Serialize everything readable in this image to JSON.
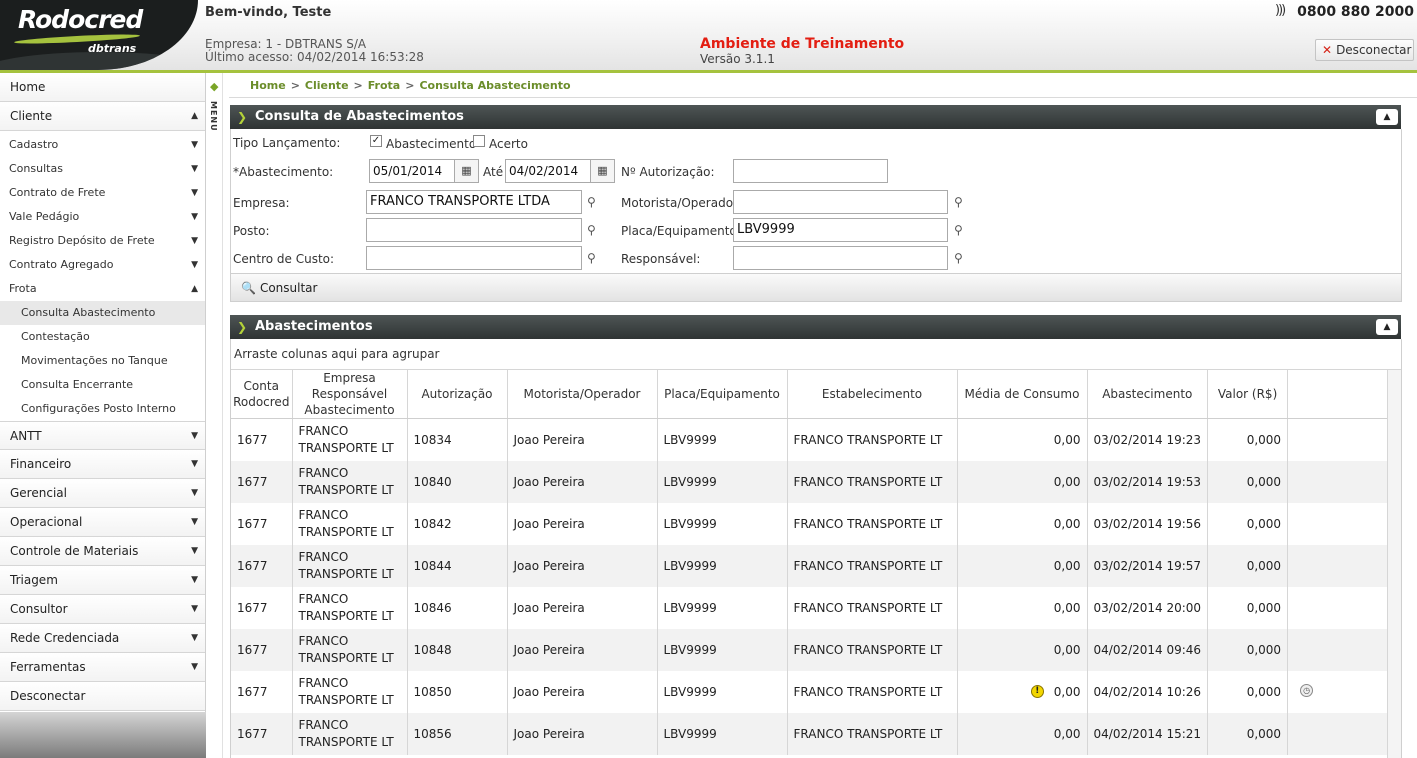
{
  "header": {
    "logo": "Rodocred",
    "logo_sub": "dbtrans",
    "welcome": "Bem-vindo, Teste",
    "empresa": "Empresa: 1 - DBTRANS S/A",
    "ultimo_acesso": "Último acesso: 04/02/2014 16:53:28",
    "env_title": "Ambiente de Treinamento",
    "env_version": "Versão 3.1.1",
    "phone": "0800 880 2000",
    "logout_label": "Desconectar",
    "accent_color": "#a5c23e"
  },
  "sidebar": {
    "home": "Home",
    "cliente": "Cliente",
    "cliente_items": [
      "Cadastro",
      "Consultas",
      "Contrato de Frete",
      "Vale Pedágio",
      "Registro Depósito de Frete",
      "Contrato Agregado"
    ],
    "frota": "Frota",
    "frota_items": [
      "Consulta Abastecimento",
      "Contestação",
      "Movimentações no Tanque",
      "Consulta Encerrante",
      "Configurações Posto Interno"
    ],
    "bottom_items": [
      "ANTT",
      "Financeiro",
      "Gerencial",
      "Operacional",
      "Controle de Materiais",
      "Triagem",
      "Consultor",
      "Rede Credenciada",
      "Ferramentas"
    ],
    "desconectar": "Desconectar",
    "menu_label": "MENU"
  },
  "breadcrumb": [
    "Home",
    "Cliente",
    "Frota",
    "Consulta Abastecimento"
  ],
  "form": {
    "title": "Consulta de Abastecimentos",
    "tipo_label": "Tipo Lançamento:",
    "tipo_abastecimento": "Abastecimento",
    "tipo_acerto": "Acerto",
    "abastecimento_label": "*Abastecimento:",
    "data_inicio": "05/01/2014",
    "ate_label": "Até",
    "data_fim": "04/02/2014",
    "autorizacao_label": "Nº Autorização:",
    "autorizacao_value": "",
    "empresa_label": "Empresa:",
    "empresa_value": "FRANCO TRANSPORTE LTDA",
    "motorista_label": "Motorista/Operador:",
    "motorista_value": "",
    "posto_label": "Posto:",
    "posto_value": "",
    "placa_label": "Placa/Equipamento:",
    "placa_value": "LBV9999",
    "centro_label": "Centro de Custo:",
    "centro_value": "",
    "responsavel_label": "Responsável:",
    "responsavel_value": "",
    "consultar_label": "Consultar"
  },
  "grid": {
    "title": "Abastecimentos",
    "group_hint": "Arraste colunas aqui para agrupar",
    "columns": [
      "Conta Rodocred",
      "Empresa Responsável Abastecimento",
      "Autorização",
      "Motorista/Operador",
      "Placa/Equipamento",
      "Estabelecimento",
      "Média de Consumo",
      "Abastecimento",
      "Valor (R$)"
    ],
    "rows": [
      {
        "conta": "1677",
        "empresa": "FRANCO TRANSPORTE LT",
        "autorizacao": "10834",
        "motorista": "Joao Pereira",
        "placa": "LBV9999",
        "estab": "FRANCO TRANSPORTE LT",
        "media": "0,00",
        "data": "03/02/2014 19:23",
        "valor": "0,000"
      },
      {
        "conta": "1677",
        "empresa": "FRANCO TRANSPORTE LT",
        "autorizacao": "10840",
        "motorista": "Joao Pereira",
        "placa": "LBV9999",
        "estab": "FRANCO TRANSPORTE LT",
        "media": "0,00",
        "data": "03/02/2014 19:53",
        "valor": "0,000"
      },
      {
        "conta": "1677",
        "empresa": "FRANCO TRANSPORTE LT",
        "autorizacao": "10842",
        "motorista": "Joao Pereira",
        "placa": "LBV9999",
        "estab": "FRANCO TRANSPORTE LT",
        "media": "0,00",
        "data": "03/02/2014 19:56",
        "valor": "0,000"
      },
      {
        "conta": "1677",
        "empresa": "FRANCO TRANSPORTE LT",
        "autorizacao": "10844",
        "motorista": "Joao Pereira",
        "placa": "LBV9999",
        "estab": "FRANCO TRANSPORTE LT",
        "media": "0,00",
        "data": "03/02/2014 19:57",
        "valor": "0,000"
      },
      {
        "conta": "1677",
        "empresa": "FRANCO TRANSPORTE LT",
        "autorizacao": "10846",
        "motorista": "Joao Pereira",
        "placa": "LBV9999",
        "estab": "FRANCO TRANSPORTE LT",
        "media": "0,00",
        "data": "03/02/2014 20:00",
        "valor": "0,000"
      },
      {
        "conta": "1677",
        "empresa": "FRANCO TRANSPORTE LT",
        "autorizacao": "10848",
        "motorista": "Joao Pereira",
        "placa": "LBV9999",
        "estab": "FRANCO TRANSPORTE LT",
        "media": "0,00",
        "data": "04/02/2014 09:46",
        "valor": "0,000"
      },
      {
        "conta": "1677",
        "empresa": "FRANCO TRANSPORTE LT",
        "autorizacao": "10850",
        "motorista": "Joao Pereira",
        "placa": "LBV9999",
        "estab": "FRANCO TRANSPORTE LT",
        "media": "0,00",
        "data": "04/02/2014 10:26",
        "valor": "0,000",
        "warning": true,
        "clock": true
      },
      {
        "conta": "1677",
        "empresa": "FRANCO TRANSPORTE LT",
        "autorizacao": "10856",
        "motorista": "Joao Pereira",
        "placa": "LBV9999",
        "estab": "FRANCO TRANSPORTE LT",
        "media": "0,00",
        "data": "04/02/2014 15:21",
        "valor": "0,000"
      }
    ]
  }
}
